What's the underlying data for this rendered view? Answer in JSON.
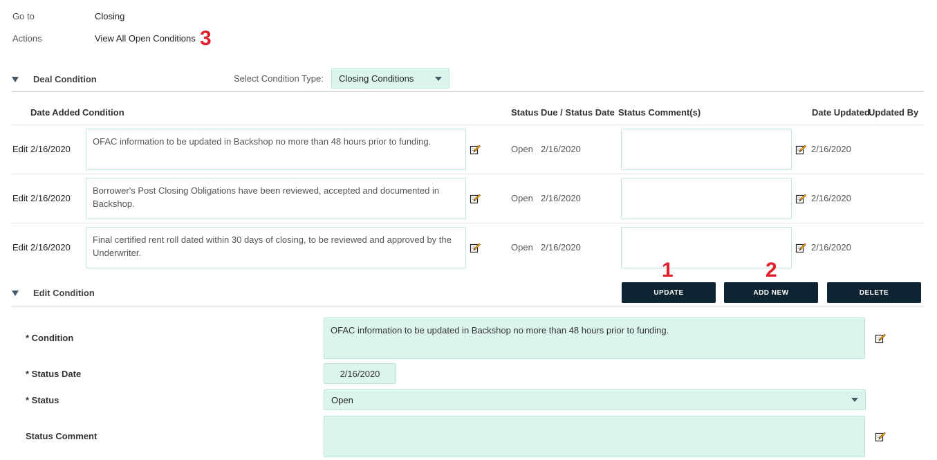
{
  "top": {
    "goto_label": "Go to",
    "goto_value": "Closing",
    "actions_label": "Actions",
    "actions_link": "View All Open Conditions",
    "annotation": "3"
  },
  "deal_condition": {
    "title": "Deal Condition",
    "select_label": "Select Condition Type:",
    "select_value": "Closing Conditions"
  },
  "table": {
    "headers": {
      "date_added": "Date Added",
      "condition": "Condition",
      "status": "Status",
      "due_status_date": "Due / Status Date",
      "status_comments": "Status Comment(s)",
      "date_updated": "Date Updated",
      "updated_by": "Updated By"
    },
    "rows": [
      {
        "edit": "Edit",
        "date_added": "2/16/2020",
        "condition": "OFAC information to be updated in Backshop no more than 48 hours prior to funding.",
        "status": "Open",
        "due_date": "2/16/2020",
        "comment": "",
        "date_updated": "2/16/2020"
      },
      {
        "edit": "Edit",
        "date_added": "2/16/2020",
        "condition": "Borrower's Post Closing Obligations have been reviewed, accepted and documented in Backshop.",
        "status": "Open",
        "due_date": "2/16/2020",
        "comment": "",
        "date_updated": "2/16/2020"
      },
      {
        "edit": "Edit",
        "date_added": "2/16/2020",
        "condition": "Final certified rent roll dated within 30 days of closing, to be reviewed and approved by the Underwriter.",
        "status": "Open",
        "due_date": "2/16/2020",
        "comment": "",
        "date_updated": "2/16/2020"
      }
    ]
  },
  "annotations": {
    "one": "1",
    "two": "2"
  },
  "edit_condition": {
    "title": "Edit Condition",
    "buttons": {
      "update": "UPDATE",
      "add_new": "ADD NEW",
      "delete": "DELETE"
    },
    "fields": {
      "condition_label": "* Condition",
      "condition_value": "OFAC information to be updated in Backshop no more than 48 hours prior to funding.",
      "status_date_label": "* Status Date",
      "status_date_value": "2/16/2020",
      "status_label": "* Status",
      "status_value": "Open",
      "status_comment_label": "Status Comment",
      "status_comment_value": ""
    }
  },
  "icons": {
    "edit": "pencil-note-icon",
    "collapse": "triangle-down-icon",
    "dropdown": "caret-down-icon"
  },
  "colors": {
    "button_bg": "#0f2433",
    "field_bg": "#dcf5ec",
    "annotation_red": "#e0202a"
  }
}
